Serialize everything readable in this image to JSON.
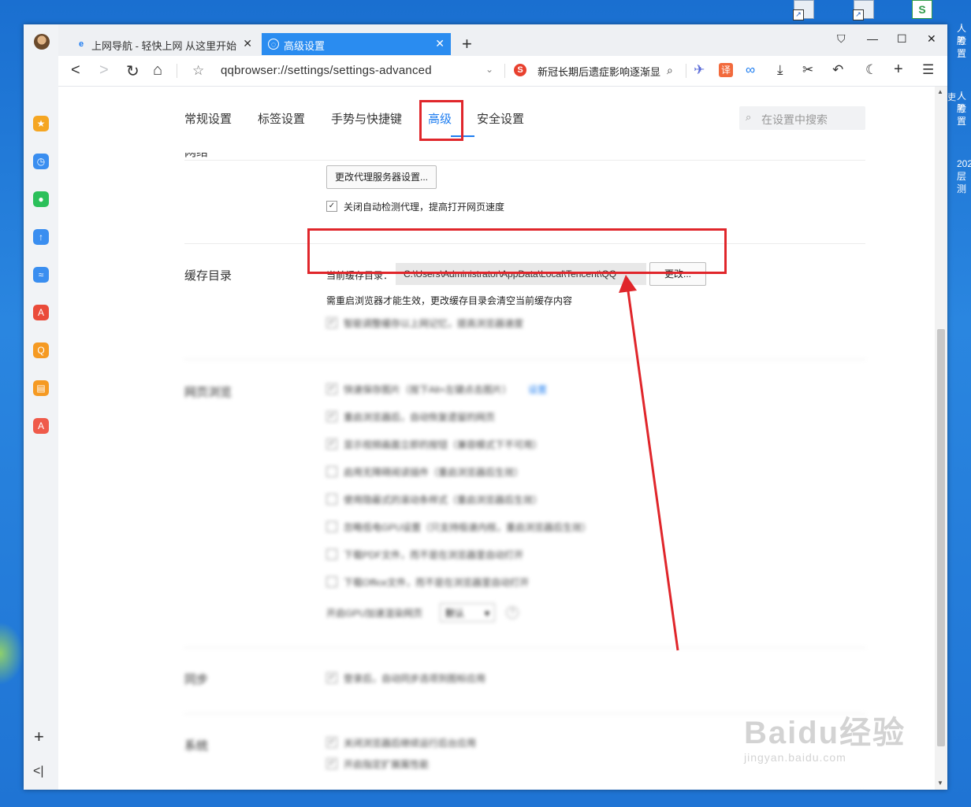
{
  "desktop": {
    "right_texts": [
      "人脸",
      "考置",
      "人脸",
      "考置",
      "202",
      "层测"
    ],
    "left_fragment": "吏"
  },
  "sidebar": {
    "icons": [
      {
        "name": "favorites-icon",
        "color": "#f5a623",
        "glyph": "★"
      },
      {
        "name": "history-icon",
        "color": "#3a8ef0",
        "glyph": "◷"
      },
      {
        "name": "wechat-icon",
        "color": "#2bc05a",
        "glyph": "●"
      },
      {
        "name": "transfer-icon",
        "color": "#3a8ef0",
        "glyph": "↑"
      },
      {
        "name": "cloud-icon",
        "color": "#3a8ef0",
        "glyph": "≈"
      },
      {
        "name": "pdf-icon",
        "color": "#ea4b3a",
        "glyph": "A"
      },
      {
        "name": "search-tool-icon",
        "color": "#f59a23",
        "glyph": "Q"
      },
      {
        "name": "reader-icon",
        "color": "#f59a23",
        "glyph": "▤"
      },
      {
        "name": "translate-tool-icon",
        "color": "#ef5a4a",
        "glyph": "A"
      }
    ],
    "add_label": "+",
    "collapse_label": "<|"
  },
  "tabs": [
    {
      "label": "上网导航 - 轻快上网 从这里开始",
      "icon": "e",
      "close": "✕"
    },
    {
      "label": "高级设置",
      "icon": "◌",
      "close": "✕"
    }
  ],
  "new_tab_label": "+",
  "window_controls": {
    "pin": "⛉",
    "minimize": "—",
    "maximize": "☐",
    "close": "✕"
  },
  "address": {
    "url": "qqbrowser://settings/settings-advanced",
    "news_text": "新冠长期后遗症影响逐渐显",
    "translate_label": "译"
  },
  "settings": {
    "tabs": [
      "常规设置",
      "标签设置",
      "手势与快捷键",
      "高级",
      "安全设置"
    ],
    "active_tab": "高级",
    "search_placeholder": "在设置中搜索",
    "network": {
      "title_fragment": "网络",
      "proxy_button": "更改代理服务器设置...",
      "auto_detect_label": "关闭自动检测代理，提高打开网页速度",
      "auto_detect_checked": true
    },
    "cache": {
      "title": "缓存目录",
      "current_label": "当前缓存目录：",
      "path": "C:\\Users\\Administrator\\AppData\\Local\\Tencent\\QQ",
      "change_button": "更改...",
      "note": "需重启浏览器才能生效，更改缓存目录会清空当前缓存内容",
      "smart_label": "智能调整缓存以上网记忆，提高浏览器速度"
    },
    "browsing": {
      "title": "网页浏览",
      "items": [
        {
          "label": "快速保存图片（按下Alt+左键点击图片）",
          "checked": true,
          "link": "设置"
        },
        {
          "label": "重启浏览器后，自动恢复遗留的网页",
          "checked": true
        },
        {
          "label": "显示视频画面立即的按钮（兼容模式下不可用）",
          "checked": true
        },
        {
          "label": "启用无障碍阅读插件（重启浏览器后生效）",
          "checked": false
        },
        {
          "label": "使用隐蔽式的滚动条样式（重启浏览器后生效）",
          "checked": false
        },
        {
          "label": "忽略低电GPU设置（只支持极速内核，重启浏览器后生效）",
          "checked": false
        },
        {
          "label": "下载PDF文件，而不是在浏览器里自动打开",
          "checked": false
        },
        {
          "label": "下载Office文件，而不是在浏览器里自动打开",
          "checked": false
        }
      ],
      "gpu_label": "开启GPU加速渲染网页",
      "gpu_value": "默认",
      "help_glyph": "?"
    },
    "sync": {
      "title": "同步",
      "label": "登录后，自动同步选项到图标应用"
    },
    "system": {
      "title": "系统",
      "items": [
        {
          "label": "关闭浏览器后继续运行后台应用",
          "checked": true
        },
        {
          "label": "开启指定扩展属性能",
          "checked": true
        }
      ]
    }
  },
  "watermark": {
    "big": "Baidu经验",
    "small": "jingyan.baidu.com"
  }
}
